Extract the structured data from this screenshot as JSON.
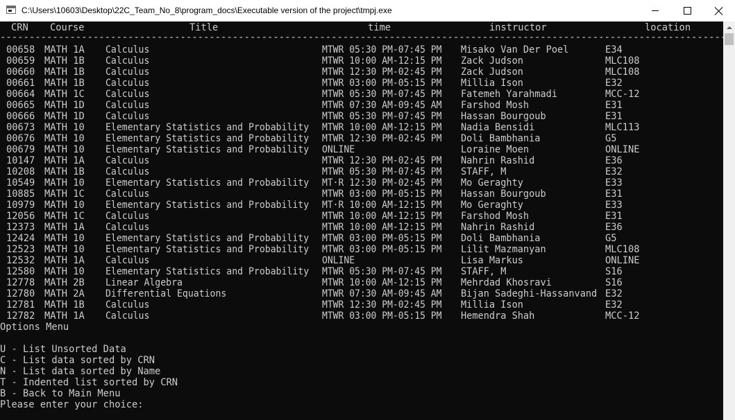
{
  "window": {
    "title": "C:\\Users\\10603\\Desktop\\22C_Team_No_8\\program_docs\\Executable version of the project\\tmpj.exe"
  },
  "icons": {
    "app": "console-window-icon",
    "minimize": "minimize-icon",
    "maximize": "maximize-icon",
    "close": "close-icon",
    "scroll_up": "scroll-up-arrow-icon"
  },
  "colors": {
    "console_bg": "#0c0c0c",
    "console_text": "#cccccc",
    "titlebar_bg": "#ffffff"
  },
  "table": {
    "headers": {
      "crn": "CRN",
      "course": "Course",
      "title": "Title",
      "time": "time",
      "instructor": "instructor",
      "location": "location"
    },
    "divider": "--------------------------------------------------------------------------------------------------------------------------------------",
    "rows": [
      {
        "crn": "00658",
        "course": "MATH 1A",
        "title": "Calculus",
        "time": "MTWR 05:30 PM-07:45 PM",
        "instructor": "Misako Van Der Poel",
        "location": "E34"
      },
      {
        "crn": "00659",
        "course": "MATH 1B",
        "title": "Calculus",
        "time": "MTWR 10:00 AM-12:15 PM",
        "instructor": "Zack Judson",
        "location": "MLC108"
      },
      {
        "crn": "00660",
        "course": "MATH 1B",
        "title": "Calculus",
        "time": "MTWR 12:30 PM-02:45 PM",
        "instructor": "Zack Judson",
        "location": "MLC108"
      },
      {
        "crn": "00661",
        "course": "MATH 1B",
        "title": "Calculus",
        "time": "MTWR 03:00 PM-05:15 PM",
        "instructor": "Millia Ison",
        "location": "E32"
      },
      {
        "crn": "00664",
        "course": "MATH 1C",
        "title": "Calculus",
        "time": "MTWR 05:30 PM-07:45 PM",
        "instructor": "Fatemeh Yarahmadi",
        "location": "MCC-12"
      },
      {
        "crn": "00665",
        "course": "MATH 1D",
        "title": "Calculus",
        "time": "MTWR 07:30 AM-09:45 AM",
        "instructor": "Farshod Mosh",
        "location": "E31"
      },
      {
        "crn": "00666",
        "course": "MATH 1D",
        "title": "Calculus",
        "time": "MTWR 05:30 PM-07:45 PM",
        "instructor": "Hassan Bourgoub",
        "location": "E31"
      },
      {
        "crn": "00673",
        "course": "MATH 10",
        "title": "Elementary Statistics and Probability",
        "time": "MTWR 10:00 AM-12:15 PM",
        "instructor": "Nadia Bensidi",
        "location": "MLC113"
      },
      {
        "crn": "00676",
        "course": "MATH 10",
        "title": "Elementary Statistics and Probability",
        "time": "MTWR 12:30 PM-02:45 PM",
        "instructor": "Doli Bambhania",
        "location": "G5"
      },
      {
        "crn": "00679",
        "course": "MATH 10",
        "title": "Elementary Statistics and Probability",
        "time": "ONLINE",
        "instructor": "Loraine Moen",
        "location": "ONLINE"
      },
      {
        "crn": "10147",
        "course": "MATH 1A",
        "title": "Calculus",
        "time": "MTWR 12:30 PM-02:45 PM",
        "instructor": "Nahrin Rashid",
        "location": "E36"
      },
      {
        "crn": "10208",
        "course": "MATH 1B",
        "title": "Calculus",
        "time": "MTWR 05:30 PM-07:45 PM",
        "instructor": "STAFF, M",
        "location": "E32"
      },
      {
        "crn": "10549",
        "course": "MATH 10",
        "title": "Elementary Statistics and Probability",
        "time": "MT·R 12:30 PM-02:45 PM",
        "instructor": "Mo Geraghty",
        "location": "E33"
      },
      {
        "crn": "10885",
        "course": "MATH 1C",
        "title": "Calculus",
        "time": "MTWR 03:00 PM-05:15 PM",
        "instructor": "Hassan Bourgoub",
        "location": "E31"
      },
      {
        "crn": "10979",
        "course": "MATH 10",
        "title": "Elementary Statistics and Probability",
        "time": "MT·R 10:00 AM-12:15 PM",
        "instructor": "Mo Geraghty",
        "location": "E33"
      },
      {
        "crn": "12056",
        "course": "MATH 1C",
        "title": "Calculus",
        "time": "MTWR 10:00 AM-12:15 PM",
        "instructor": "Farshod Mosh",
        "location": "E31"
      },
      {
        "crn": "12373",
        "course": "MATH 1A",
        "title": "Calculus",
        "time": "MTWR 10:00 AM-12:15 PM",
        "instructor": "Nahrin Rashid",
        "location": "E36"
      },
      {
        "crn": "12424",
        "course": "MATH 10",
        "title": "Elementary Statistics and Probability",
        "time": "MTWR 03:00 PM-05:15 PM",
        "instructor": "Doli Bambhania",
        "location": "G5"
      },
      {
        "crn": "12523",
        "course": "MATH 10",
        "title": "Elementary Statistics and Probability",
        "time": "MTWR 03:00 PM-05:15 PM",
        "instructor": "Lilit Mazmanyan",
        "location": "MLC108"
      },
      {
        "crn": "12532",
        "course": "MATH 1A",
        "title": "Calculus",
        "time": "ONLINE",
        "instructor": "Lisa Markus",
        "location": "ONLINE"
      },
      {
        "crn": "12580",
        "course": "MATH 10",
        "title": "Elementary Statistics and Probability",
        "time": "MTWR 05:30 PM-07:45 PM",
        "instructor": "STAFF, M",
        "location": "S16"
      },
      {
        "crn": "12778",
        "course": "MATH 2B",
        "title": "Linear Algebra",
        "time": "MTWR 10:00 AM-12:15 PM",
        "instructor": "Mehrdad Khosravi",
        "location": "S16"
      },
      {
        "crn": "12780",
        "course": "MATH 2A",
        "title": "Differential Equations",
        "time": "MTWR 07:30 AM-09:45 AM",
        "instructor": "Bijan Sadeghi-Hassanvand",
        "location": "E32"
      },
      {
        "crn": "12781",
        "course": "MATH 1B",
        "title": "Calculus",
        "time": "MTWR 12:30 PM-02:45 PM",
        "instructor": "Millia Ison",
        "location": "E32"
      },
      {
        "crn": "12782",
        "course": "MATH 1A",
        "title": "Calculus",
        "time": "MTWR 03:00 PM-05:15 PM",
        "instructor": "Hemendra Shah",
        "location": "MCC-12"
      }
    ]
  },
  "menu": {
    "title": "Options Menu",
    "items": [
      "U - List Unsorted Data",
      "C - List data sorted by CRN",
      "N - List data sorted by Name",
      "T - Indented list sorted by CRN",
      "B - Back to Main Menu"
    ],
    "prompt": "Please enter your choice:"
  }
}
